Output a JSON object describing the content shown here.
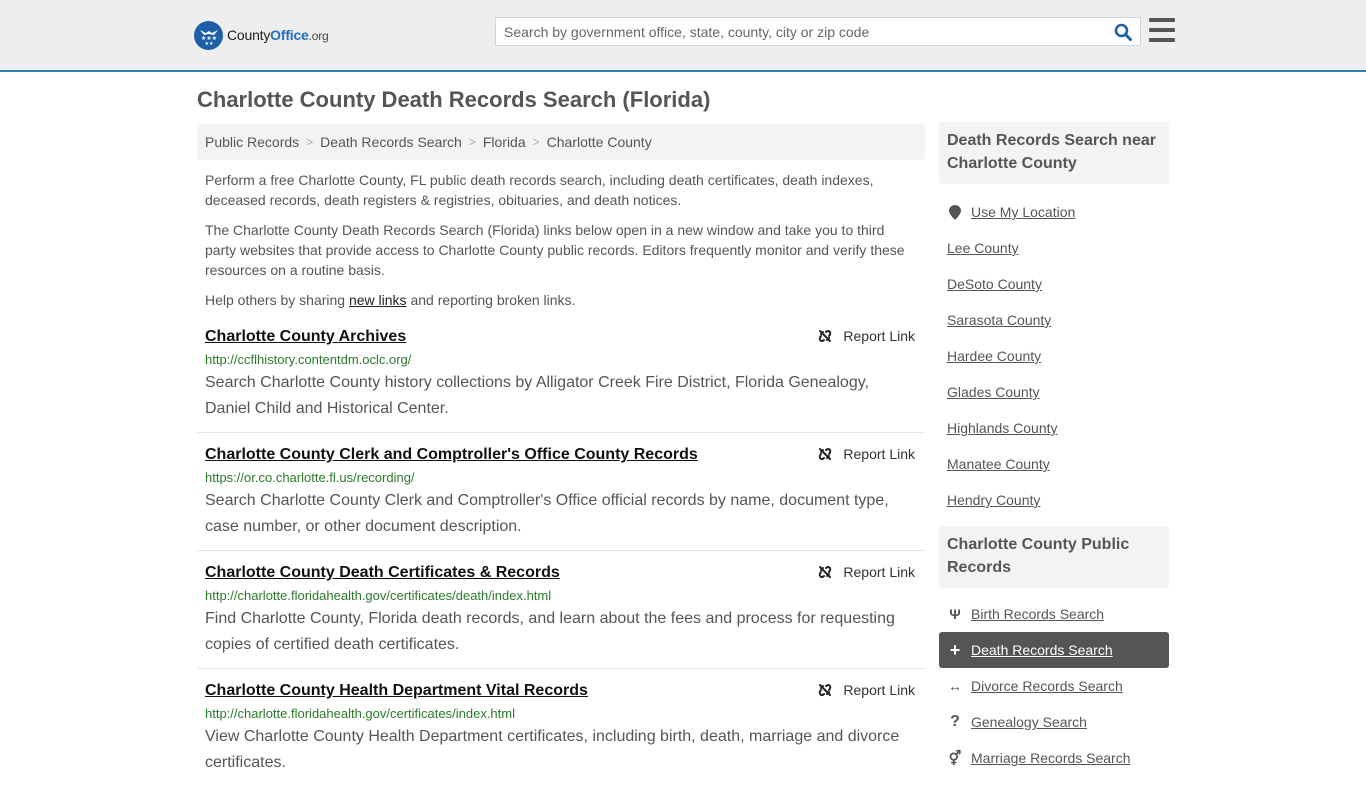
{
  "header": {
    "logo": {
      "name_part1": "County",
      "name_part2": "Office",
      "name_suffix": ".org"
    },
    "search": {
      "placeholder": "Search by government office, state, county, city or zip code",
      "value": ""
    },
    "colors": {
      "accent": "#3a7fb2",
      "brand": "#1f5fa8",
      "search_icon": "#1f5fa8"
    }
  },
  "page": {
    "title": "Charlotte County Death Records Search (Florida)"
  },
  "breadcrumb": [
    {
      "label": "Public Records"
    },
    {
      "label": "Death Records Search"
    },
    {
      "label": "Florida"
    },
    {
      "label": "Charlotte County"
    }
  ],
  "intro": {
    "p1": "Perform a free Charlotte County, FL public death records search, including death certificates, death indexes, deceased records, death registers & registries, obituaries, and death notices.",
    "p2": "The Charlotte County Death Records Search (Florida) links below open in a new window and take you to third party websites that provide access to Charlotte County public records. Editors frequently monitor and verify these resources on a routine basis.",
    "p3_before": "Help others by sharing ",
    "p3_link": "new links",
    "p3_after": " and reporting broken links."
  },
  "results": [
    {
      "title": "Charlotte County Archives",
      "url": "http://ccflhistory.contentdm.oclc.org/",
      "description": "Search Charlotte County history collections by Alligator Creek Fire District, Florida Genealogy, Daniel Child and Historical Center.",
      "report_label": "Report Link"
    },
    {
      "title": "Charlotte County Clerk and Comptroller's Office County Records",
      "url": "https://or.co.charlotte.fl.us/recording/",
      "description": "Search Charlotte County Clerk and Comptroller's Office official records by name, document type, case number, or other document description.",
      "report_label": "Report Link"
    },
    {
      "title": "Charlotte County Death Certificates & Records",
      "url": "http://charlotte.floridahealth.gov/certificates/death/index.html",
      "description": "Find Charlotte County, Florida death records, and learn about the fees and process for requesting copies of certified death certificates.",
      "report_label": "Report Link"
    },
    {
      "title": "Charlotte County Health Department Vital Records",
      "url": "http://charlotte.floridahealth.gov/certificates/index.html",
      "description": "View Charlotte County Health Department certificates, including birth, death, marriage and divorce certificates.",
      "report_label": "Report Link"
    }
  ],
  "sidebar": {
    "nearby": {
      "heading": "Death Records Search near Charlotte County",
      "use_location": {
        "label": "Use My Location",
        "icon": "map-marker-icon"
      },
      "items": [
        {
          "label": "Lee County"
        },
        {
          "label": "DeSoto County"
        },
        {
          "label": "Sarasota County"
        },
        {
          "label": "Hardee County"
        },
        {
          "label": "Glades County"
        },
        {
          "label": "Highlands County"
        },
        {
          "label": "Manatee County"
        },
        {
          "label": "Hendry County"
        }
      ]
    },
    "public_records": {
      "heading": "Charlotte County Public Records",
      "items": [
        {
          "label": "Birth Records Search",
          "icon": "child-icon",
          "glyph": "Ψ",
          "active": false
        },
        {
          "label": "Death Records Search",
          "icon": "plus-icon",
          "glyph": "+",
          "active": true
        },
        {
          "label": "Divorce Records Search",
          "icon": "arrows-horizontal-icon",
          "glyph": "↔",
          "active": false
        },
        {
          "label": "Genealogy Search",
          "icon": "question-icon",
          "glyph": "?",
          "active": false
        },
        {
          "label": "Marriage Records Search",
          "icon": "marriage-icon",
          "glyph": "⚥",
          "active": false
        }
      ]
    }
  }
}
